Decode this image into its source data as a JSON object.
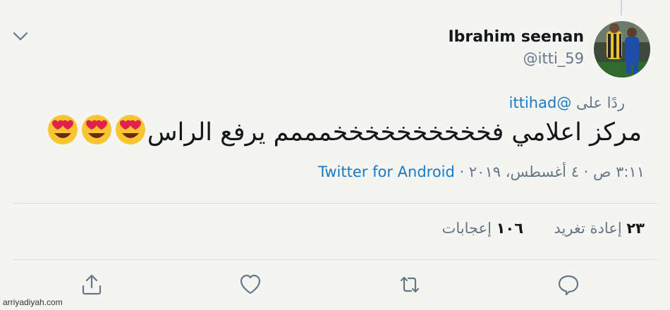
{
  "author": {
    "name": "Ibrahim seenan",
    "handle": "@itti_59"
  },
  "reply": {
    "prefix": "ردًا على",
    "mention": "@ittihad"
  },
  "tweet": {
    "text": "مركز اعلامي فخخخخخخخخخخمممم يرفع الراس",
    "emojis": [
      "smiling-face-with-heart-eyes",
      "smiling-face-with-heart-eyes",
      "smiling-face-with-heart-eyes"
    ]
  },
  "meta": {
    "time_date": "٣:١١ ص · ٤ أغسطس، ٢٠١٩ ·",
    "source": "Twitter for Android"
  },
  "stats": {
    "retweets_count": "٢٣",
    "retweets_label": "إعادة تغريد",
    "likes_count": "١٠٦",
    "likes_label": "إعجابات"
  },
  "actions": [
    "reply-icon",
    "retweet-icon",
    "like-icon",
    "share-icon"
  ],
  "watermark": "arriyadiyah.com",
  "colors": {
    "background": "#f4f4f2",
    "link": "#1b7ac4",
    "secondary_text": "#657786",
    "primary_text": "#14171a"
  }
}
